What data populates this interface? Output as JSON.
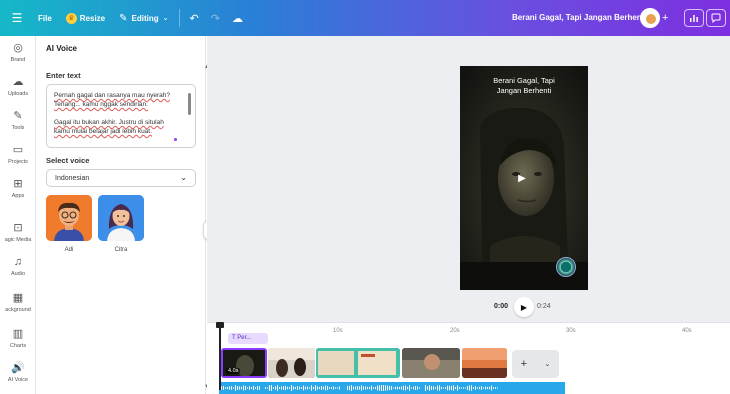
{
  "topbar": {
    "file_label": "File",
    "resize_label": "Resize",
    "editing_label": "Editing",
    "document_title": "Berani Gagal, Tapi Jangan Berhenti"
  },
  "rail": {
    "items": [
      {
        "label": "Brand",
        "icon": "brand-icon"
      },
      {
        "label": "Uploads",
        "icon": "upload-cloud-icon"
      },
      {
        "label": "Tools",
        "icon": "pen-tool-icon"
      },
      {
        "label": "Projects",
        "icon": "folder-icon"
      },
      {
        "label": "Apps",
        "icon": "apps-grid-icon"
      },
      {
        "label": "agic Media",
        "icon": "magic-media-icon"
      },
      {
        "label": "Audio",
        "icon": "music-note-icon"
      },
      {
        "label": "ackground",
        "icon": "background-icon"
      },
      {
        "label": "Charts",
        "icon": "bar-chart-icon"
      },
      {
        "label": "AI Voice",
        "icon": "ai-voice-icon"
      }
    ]
  },
  "panel": {
    "title": "AI Voice",
    "enter_text_label": "Enter text",
    "text_lines": [
      "Pernah gagal dan rasanya mau nyerah?",
      "Tenang... kamu nggak sendirian.",
      "",
      "Gagal itu bukan akhir. Justru di situlah",
      "kamu mulai belajar jadi lebih kuat."
    ],
    "select_voice_label": "Select voice",
    "language_value": "Indonesian",
    "voices": [
      {
        "name": "Adi",
        "bg": "#f07b2d"
      },
      {
        "name": "Citra",
        "bg": "#3d8ee8"
      }
    ]
  },
  "canvas": {
    "frame_title_line1": "Berani Gagal, Tapi",
    "frame_title_line2": "Jangan Berhenti"
  },
  "playback": {
    "current_time": "0:00",
    "duration": "0:24"
  },
  "timeline": {
    "ruler": [
      "10s",
      "20s",
      "30s",
      "40s"
    ],
    "text_chip": "Per...",
    "first_clip_duration": "4.0s"
  },
  "colors": {
    "accent": "#8b3dff",
    "audio_track": "#28a8ea"
  }
}
